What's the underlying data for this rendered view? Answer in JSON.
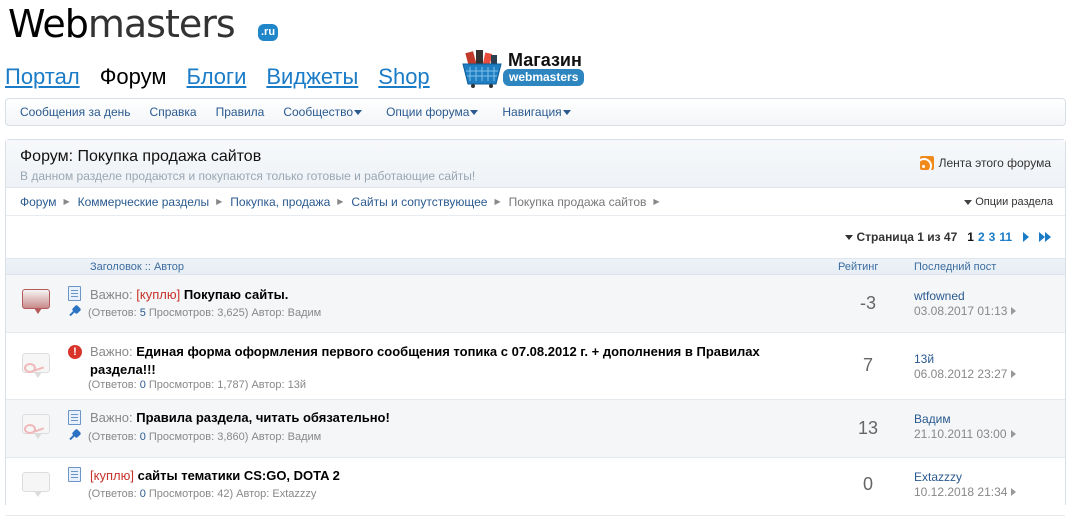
{
  "logo": {
    "text_dark": "Web",
    "text_light": "masters",
    "ru": ".ru"
  },
  "mainnav": {
    "items": [
      {
        "label": "Портал",
        "active": false
      },
      {
        "label": "Форум",
        "active": true
      },
      {
        "label": "Блоги",
        "active": false
      },
      {
        "label": "Виджеты",
        "active": false
      },
      {
        "label": "Shop",
        "active": false
      }
    ]
  },
  "shop": {
    "title": "Магазин",
    "sub": "webmasters"
  },
  "subnav": {
    "items": [
      {
        "label": "Сообщения за день",
        "dropdown": false
      },
      {
        "label": "Справка",
        "dropdown": false
      },
      {
        "label": "Правила",
        "dropdown": false
      },
      {
        "label": "Сообщество",
        "dropdown": true
      },
      {
        "label": "Опции форума",
        "dropdown": true
      },
      {
        "label": "Навигация",
        "dropdown": true
      }
    ]
  },
  "forum": {
    "title": "Форум: Покупка продажа сайтов",
    "description": "В данном разделе продаются и покупаются только готовые и работающие сайты!",
    "rss_label": "Лента этого форума",
    "section_options": "Опции раздела",
    "breadcrumb": [
      "Форум",
      "Коммерческие разделы",
      "Покупка, продажа",
      "Сайты и сопутствующее",
      "Покупка продажа сайтов"
    ]
  },
  "pager": {
    "label": "Страница 1 из 47",
    "pages": [
      "1",
      "2",
      "3",
      "11"
    ]
  },
  "columns": {
    "title_author": "Заголовок :: Автор",
    "rating": "Рейтинг",
    "last_post": "Последний пост"
  },
  "threads": [
    {
      "prefix": "Важно:",
      "tag": "[куплю]",
      "title": "Покупаю сайты.",
      "meta_pre": "(Ответов: ",
      "replies": "5",
      "meta_post": " Просмотров: 3,625) Автор: Вадим",
      "rating": "-3",
      "last_user": "wtfowned",
      "last_date": "03.08.2017 01:13"
    },
    {
      "prefix": "Важно:",
      "tag": "",
      "title": "Единая форма оформления первого сообщения топика с 07.08.2012 г. + дополнения в Правилах раздела!!!",
      "meta_pre": "(Ответов: ",
      "replies": "0",
      "meta_post": " Просмотров: 1,787) Автор: 13й",
      "rating": "7",
      "last_user": "13й",
      "last_date": "06.08.2012 23:27"
    },
    {
      "prefix": "Важно:",
      "tag": "",
      "title": "Правила раздела, читать обязательно!",
      "meta_pre": "(Ответов: ",
      "replies": "0",
      "meta_post": " Просмотров: 3,860) Автор: Вадим",
      "rating": "13",
      "last_user": "Вадим",
      "last_date": "21.10.2011 03:00"
    },
    {
      "prefix": "",
      "tag": "[куплю]",
      "title": "сайты тематики CS:GO, DOTA 2",
      "meta_pre": "(Ответов: ",
      "replies": "0",
      "meta_post": " Просмотров: 42) Автор: Extazzzy",
      "rating": "0",
      "last_user": "Extazzzy",
      "last_date": "10.12.2018 21:34"
    }
  ],
  "colors": {
    "link": "#2a5a8f",
    "nav_link": "#1a7bc7",
    "tag": "#c8322b",
    "rss": "#f08a1c"
  }
}
